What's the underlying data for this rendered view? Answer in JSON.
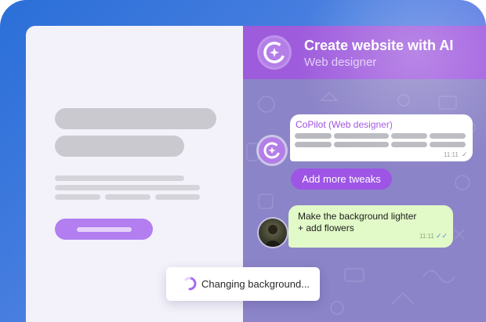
{
  "chat": {
    "title": "Create website with AI",
    "subtitle": "Web designer"
  },
  "messages": [
    {
      "sender": "CoPilot (Web designer)",
      "time": "11:11",
      "status": "sent"
    },
    {
      "text_line1": "Make the background lighter",
      "text_line2": "+ add flowers",
      "time": "11:11",
      "status": "read"
    }
  ],
  "actions": {
    "tweak_label": "Add more tweaks"
  },
  "toast": {
    "text": "Changing background..."
  },
  "icons": {
    "bot_logo": "copilot-logo-icon",
    "spinner": "loading-spinner-icon",
    "check": "check-icon",
    "double_check": "double-check-icon"
  },
  "colors": {
    "header": "#a35fe0",
    "chat_background": "#8c84c8",
    "button": "#9e55e5",
    "user_bubble": "#e2f9c8",
    "site_button": "#b27ef0"
  }
}
